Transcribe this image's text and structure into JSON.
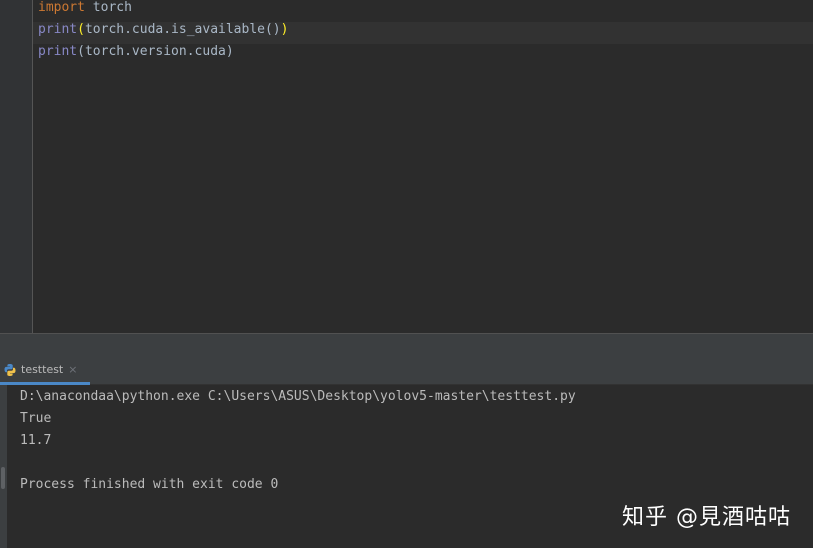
{
  "editor": {
    "lines": [
      {
        "kw": "import",
        "rest": " torch"
      },
      {
        "fn": "print",
        "open": "(",
        "middle": "torch.cuda.is_available()",
        "close": ")"
      },
      {
        "fn": "print",
        "rest": "(torch.version.cuda)"
      }
    ]
  },
  "run_panel": {
    "tab_label": "testtest",
    "tab_close": "×",
    "console_lines": [
      "D:\\anacondaa\\python.exe C:\\Users\\ASUS\\Desktop\\yolov5-master\\testtest.py",
      "True",
      "11.7",
      "",
      "Process finished with exit code 0"
    ]
  },
  "watermark": "知乎 @見酒咕咕",
  "colors": {
    "keyword": "#cc7832",
    "builtin": "#8888c6",
    "text": "#a9b7c6",
    "paren_highlight": "#ffef28",
    "tab_underline": "#4a88c7"
  }
}
